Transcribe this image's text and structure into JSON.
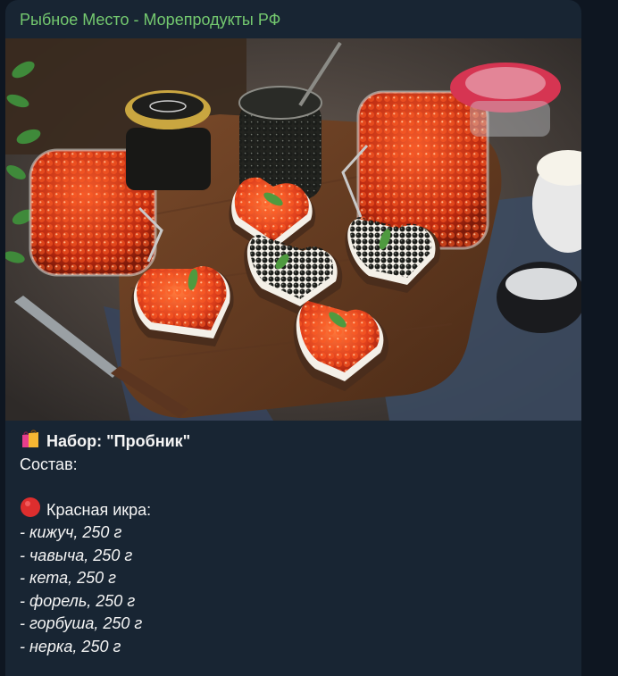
{
  "channel": {
    "name": "Рыбное Место - Морепродукты РФ",
    "name_color": "#74c96f"
  },
  "photo": {
    "icon": "caviar-photo",
    "description_icon": "seafood-photo-icon"
  },
  "post": {
    "title_icon": "shopping-bags-icon",
    "title": "Набор: \"Пробник\"",
    "composition_label": "Состав:",
    "section_icon": "red-circle-icon",
    "section_title": "Красная икра:",
    "items": [
      "- кижуч, 250 г",
      "- чавыча, 250 г",
      "- кета, 250 г",
      "- форель, 250 г",
      "- горбуша, 250 г",
      "- нерка, 250 г"
    ]
  },
  "colors": {
    "background": "#0e1621",
    "bubble": "#182533",
    "text": "#f5f5f5"
  }
}
